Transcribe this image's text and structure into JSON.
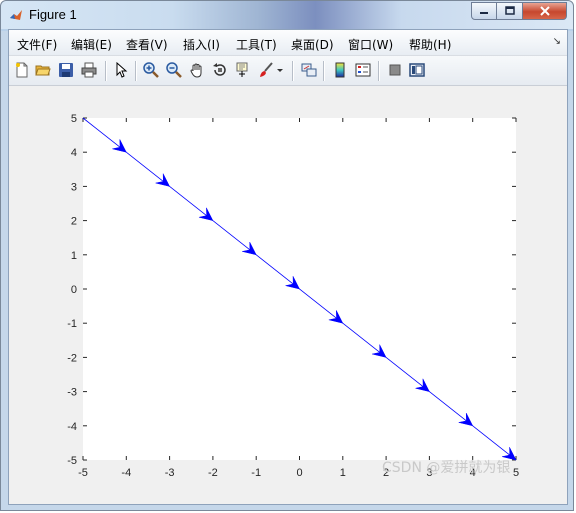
{
  "window": {
    "title": "Figure 1"
  },
  "menu": [
    {
      "label": "文件(F)"
    },
    {
      "label": "编辑(E)"
    },
    {
      "label": "查看(V)"
    },
    {
      "label": "插入(I)"
    },
    {
      "label": "工具(T)"
    },
    {
      "label": "桌面(D)"
    },
    {
      "label": "窗口(W)"
    },
    {
      "label": "帮助(H)"
    }
  ],
  "toolbar": {
    "icons": [
      "new-figure-icon",
      "open-file-icon",
      "save-icon",
      "print-icon",
      "edit-plot-arrow-icon",
      "zoom-in-icon",
      "zoom-out-icon",
      "pan-hand-icon",
      "rotate-3d-icon",
      "data-cursor-icon",
      "brush-icon",
      "link-plot-icon",
      "colorbar-icon",
      "legend-icon",
      "hide-plot-tools-icon",
      "show-plot-tools-icon"
    ]
  },
  "chart_data": {
    "type": "quiver",
    "title": "",
    "xlabel": "",
    "ylabel": "",
    "xlim": [
      -5,
      5
    ],
    "ylim": [
      -5,
      5
    ],
    "xticks": [
      -5,
      -4,
      -3,
      -2,
      -1,
      0,
      1,
      2,
      3,
      4,
      5
    ],
    "yticks": [
      -5,
      -4,
      -3,
      -2,
      -1,
      0,
      1,
      2,
      3,
      4,
      5
    ],
    "line": {
      "x": [
        -5,
        5
      ],
      "y": [
        5,
        -5
      ]
    },
    "arrows": [
      {
        "x": -4,
        "y": 4
      },
      {
        "x": -3,
        "y": 3
      },
      {
        "x": -2,
        "y": 2
      },
      {
        "x": -1,
        "y": 1
      },
      {
        "x": 0,
        "y": 0
      },
      {
        "x": 1,
        "y": -1
      },
      {
        "x": 2,
        "y": -2
      },
      {
        "x": 3,
        "y": -3
      },
      {
        "x": 4,
        "y": -4
      },
      {
        "x": 5,
        "y": -5
      }
    ],
    "direction": [
      1,
      -1
    ],
    "color": "#0000ff",
    "grid": false
  },
  "watermark": "CSDN @爱拼就为银"
}
